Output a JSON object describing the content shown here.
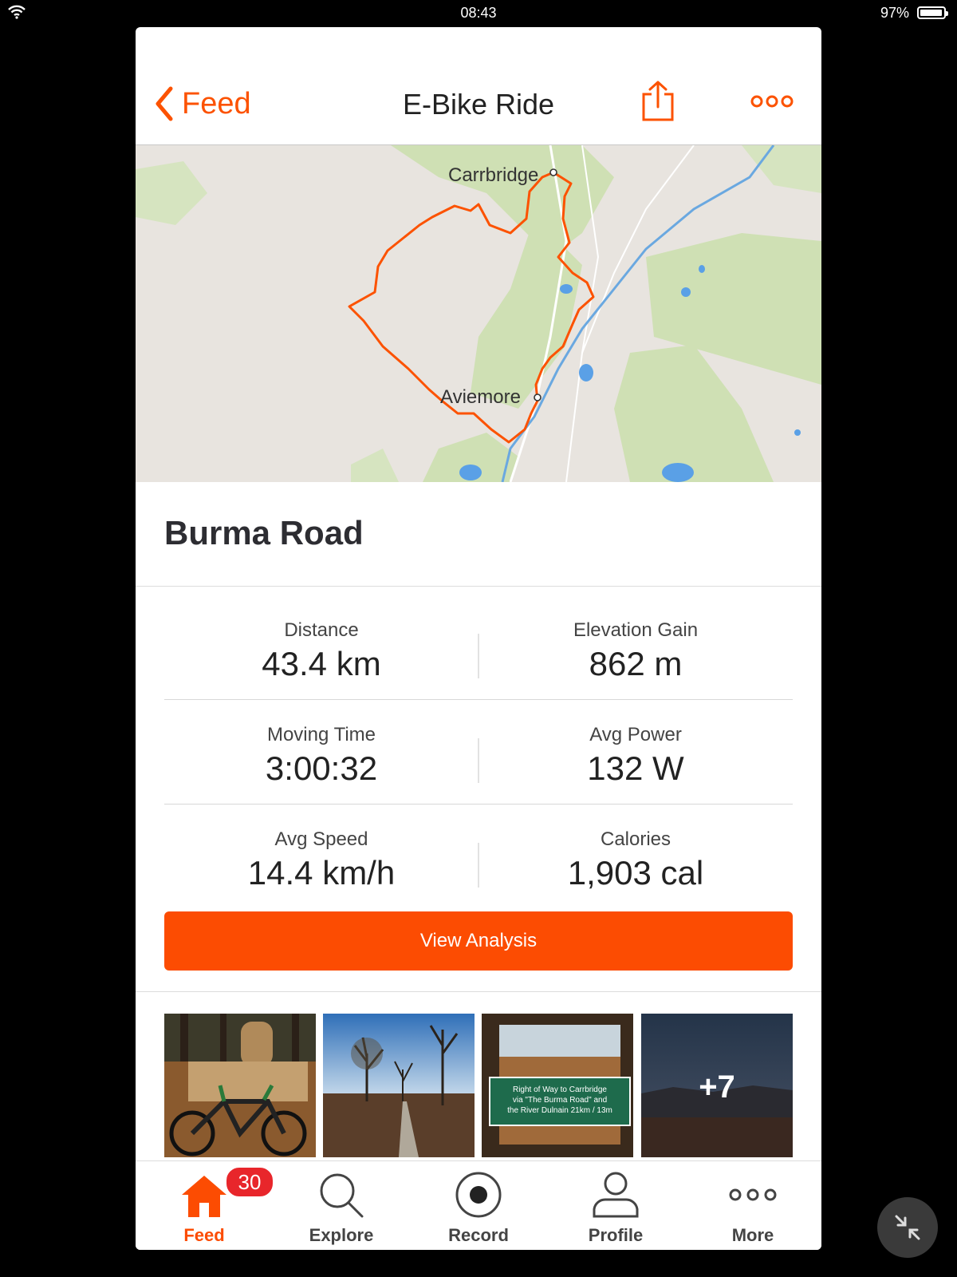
{
  "status_bar": {
    "time": "08:43",
    "battery_pct": "97%",
    "battery_level": 0.97
  },
  "nav": {
    "back_label": "Feed",
    "title": "E-Bike Ride"
  },
  "map": {
    "places": [
      "Carrbridge",
      "Aviemore"
    ],
    "route_color": "#fc5200"
  },
  "activity": {
    "name": "Burma Road"
  },
  "stats": [
    {
      "label": "Distance",
      "value": "43.4 km"
    },
    {
      "label": "Elevation Gain",
      "value": "862 m"
    },
    {
      "label": "Moving Time",
      "value": "3:00:32"
    },
    {
      "label": "Avg Power",
      "value": "132 W"
    },
    {
      "label": "Avg Speed",
      "value": "14.4 km/h"
    },
    {
      "label": "Calories",
      "value": "1,903 cal"
    }
  ],
  "view_analysis_label": "View Analysis",
  "photos": {
    "sign_text": [
      "Right of Way to Carrbridge",
      "via \"The Burma Road\" and",
      "the River Dulnain 21km / 13m"
    ],
    "more_count": "+7"
  },
  "tabbar": {
    "badge": "30",
    "tabs": [
      {
        "label": "Feed",
        "icon": "home-icon"
      },
      {
        "label": "Explore",
        "icon": "search-icon"
      },
      {
        "label": "Record",
        "icon": "record-icon"
      },
      {
        "label": "Profile",
        "icon": "profile-icon"
      },
      {
        "label": "More",
        "icon": "more-icon"
      }
    ]
  },
  "colors": {
    "accent": "#fc4c02",
    "badge": "#e8262b"
  }
}
